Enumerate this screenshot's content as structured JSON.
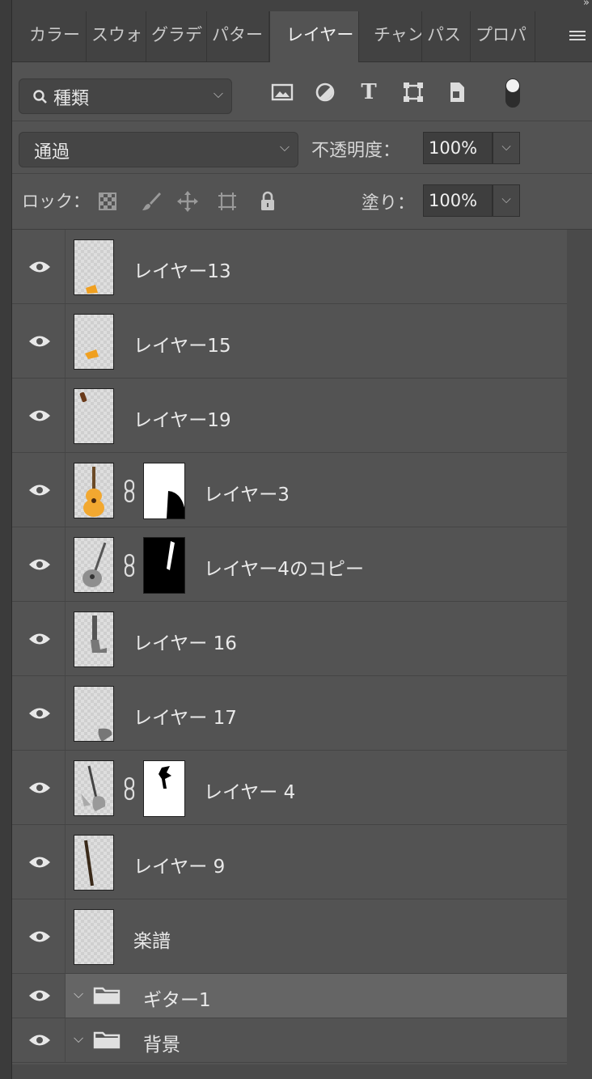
{
  "tabs": [
    {
      "label": "カラー",
      "active": false
    },
    {
      "label": "スウォ",
      "active": false
    },
    {
      "label": "グラデ",
      "active": false
    },
    {
      "label": "パター",
      "active": false
    },
    {
      "label": "レイヤー",
      "active": true
    },
    {
      "label": "チャン",
      "active": false
    },
    {
      "label": "パス",
      "active": false
    },
    {
      "label": "プロパ",
      "active": false
    }
  ],
  "collapse_glyph": "»",
  "filter": {
    "kind_label": "種類",
    "icons": [
      "image-filter-icon",
      "adjustment-filter-icon",
      "type-filter-icon",
      "shape-filter-icon",
      "smart-object-filter-icon",
      "filter-toggle-icon"
    ]
  },
  "blend": {
    "mode": "通過",
    "opacity_label": "不透明度：",
    "opacity_value": "100%"
  },
  "lock": {
    "label": "ロック：",
    "icons": [
      "lock-transparent-pixels-icon",
      "lock-image-pixels-icon",
      "lock-position-icon",
      "lock-artboard-icon",
      "lock-all-icon"
    ],
    "fill_label": "塗り：",
    "fill_value": "100%"
  },
  "layers": [
    {
      "name": "レイヤー13",
      "type": "layer",
      "mask": false,
      "content": "orange-fragment"
    },
    {
      "name": "レイヤー15",
      "type": "layer",
      "mask": false,
      "content": "orange-fragment"
    },
    {
      "name": "レイヤー19",
      "type": "layer",
      "mask": false,
      "content": "small-dark-piece"
    },
    {
      "name": "レイヤー3",
      "type": "layer",
      "mask": true,
      "mask_style": "white",
      "content": "acoustic-guitar"
    },
    {
      "name": "レイヤー4のコピー",
      "type": "layer",
      "mask": true,
      "mask_style": "black",
      "content": "gray-guitar"
    },
    {
      "name": "レイヤー 16",
      "type": "layer",
      "mask": false,
      "content": "guitar-neck"
    },
    {
      "name": "レイヤー 17",
      "type": "layer",
      "mask": false,
      "content": "gray-piece"
    },
    {
      "name": "レイヤー 4",
      "type": "layer",
      "mask": true,
      "mask_style": "white",
      "content": "guitar-splash"
    },
    {
      "name": "レイヤー 9",
      "type": "layer",
      "mask": false,
      "content": "thin-stick"
    },
    {
      "name": "楽譜",
      "type": "layer",
      "mask": false,
      "content": "faint"
    },
    {
      "name": "ギター1",
      "type": "group",
      "selected": true
    },
    {
      "name": "背景",
      "type": "group",
      "selected": false
    }
  ]
}
